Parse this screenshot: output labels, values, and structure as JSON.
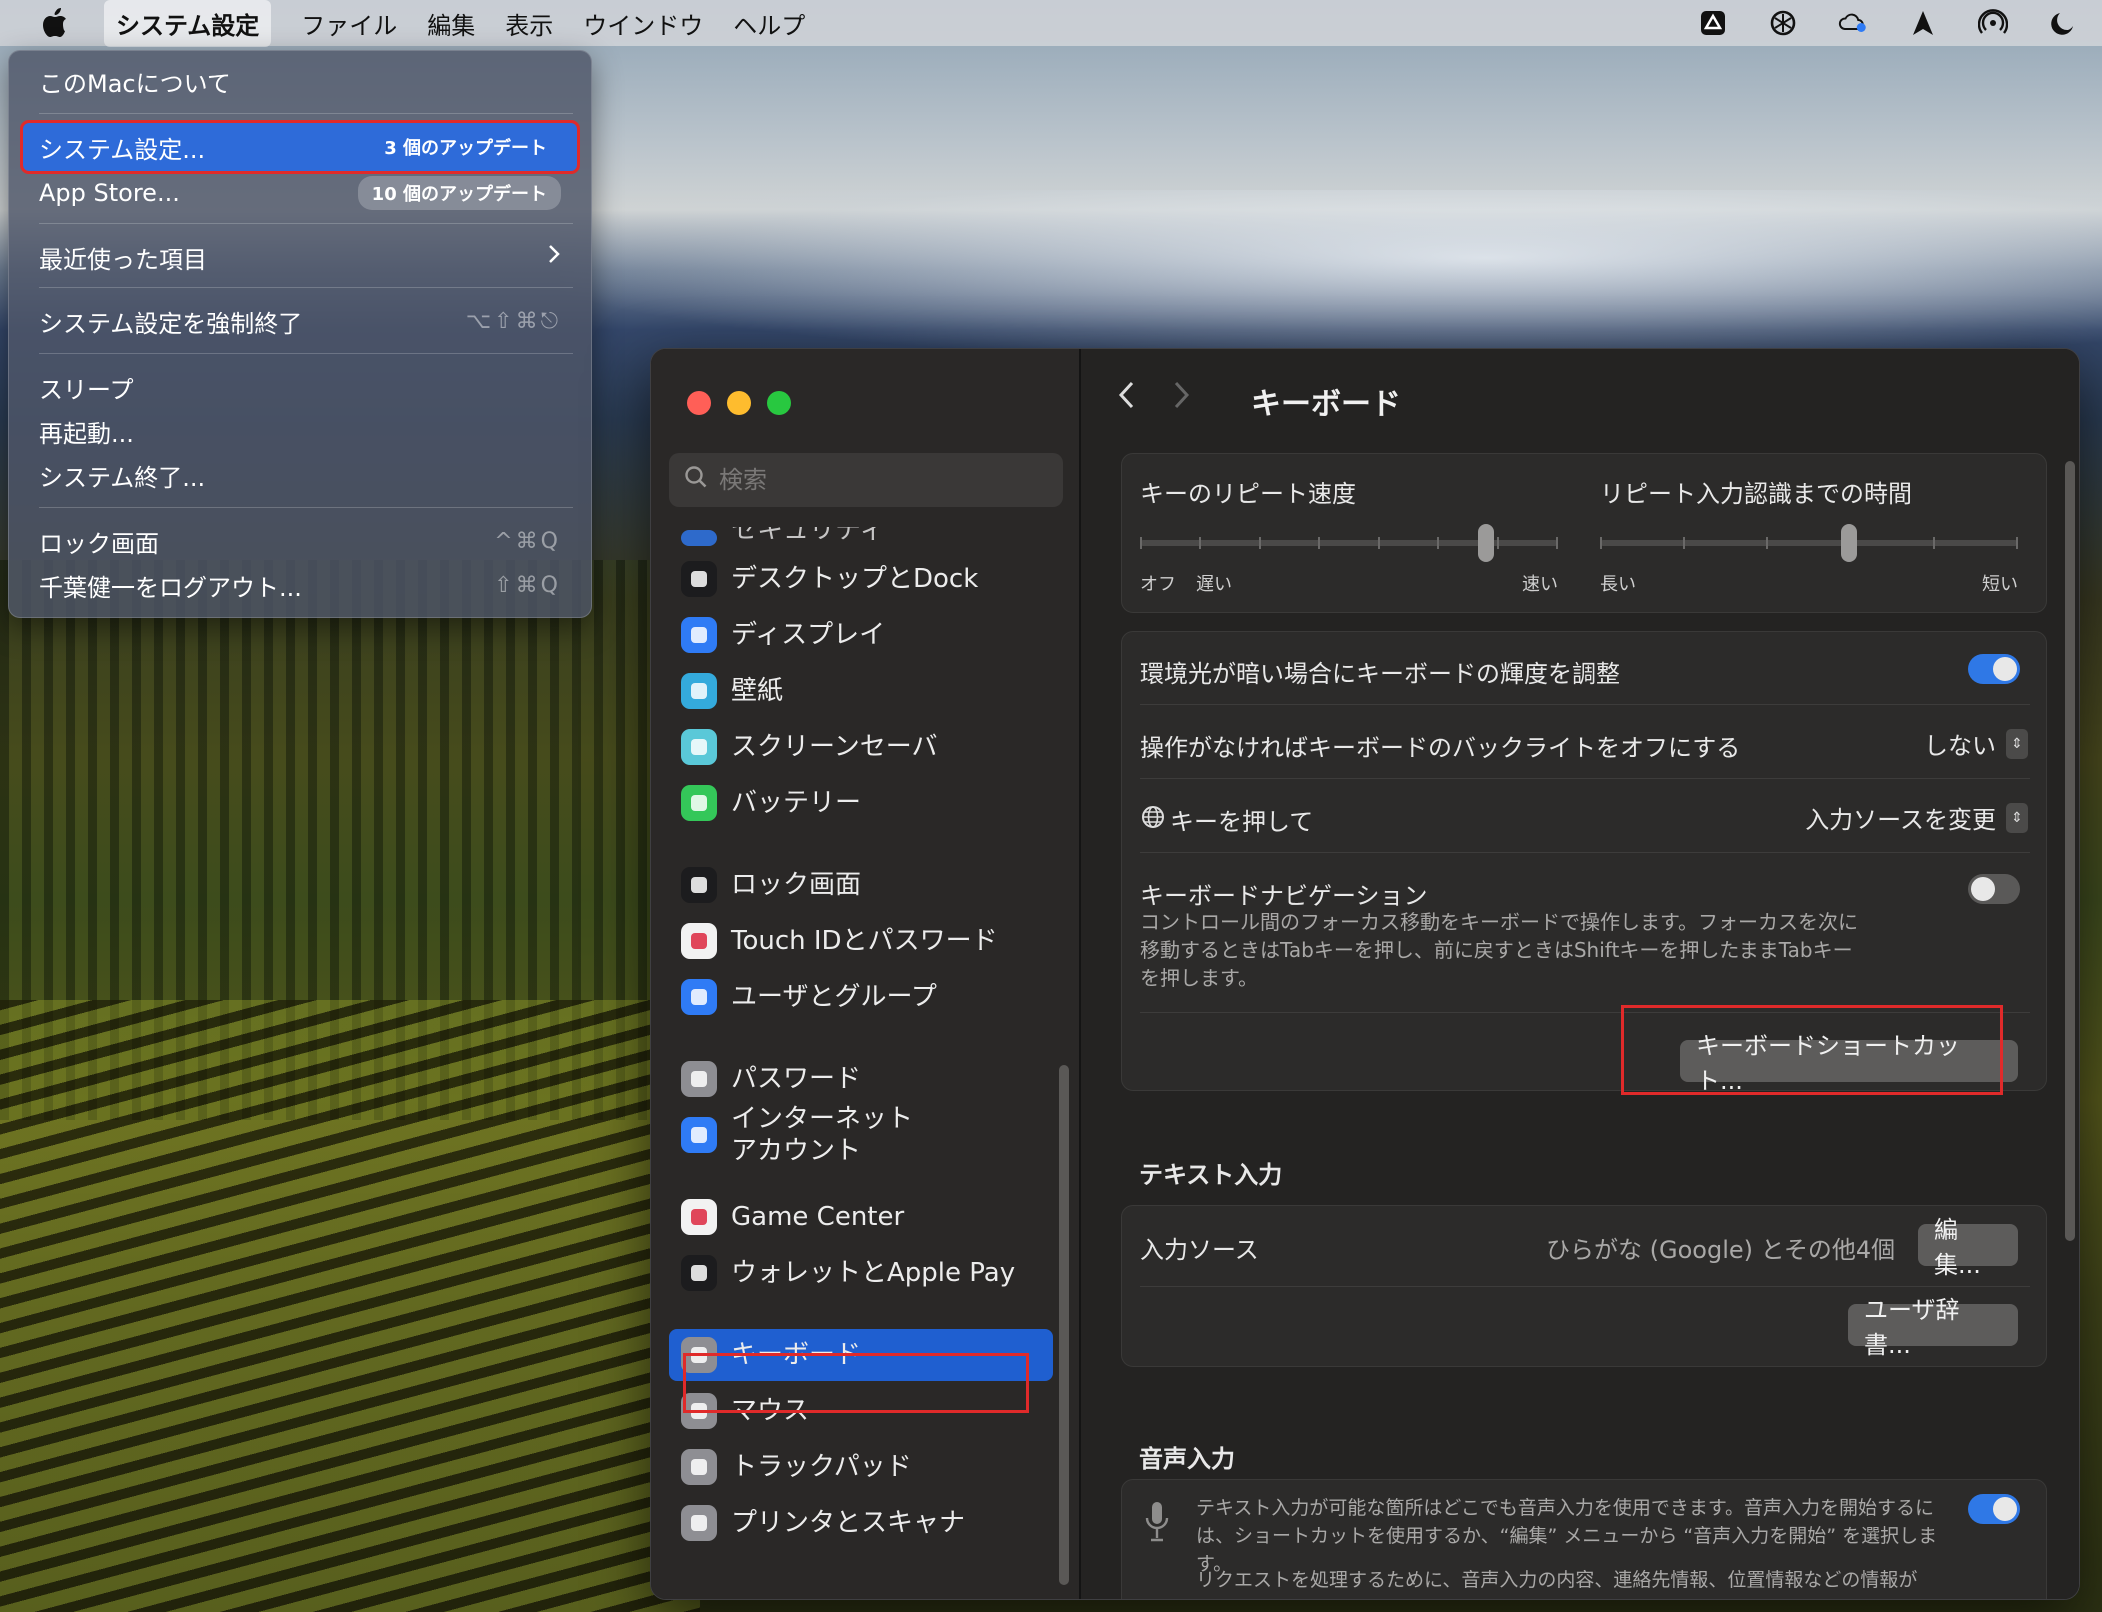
{
  "menubar": {
    "app_name": "システム設定",
    "items": [
      "ファイル",
      "編集",
      "表示",
      "ウインドウ",
      "ヘルプ"
    ],
    "status_icons": [
      "google-drive-icon",
      "chatgpt-icon",
      "cloud-sync-icon",
      "location-arrow-icon",
      "airdrop-icon",
      "dark-mode-icon"
    ]
  },
  "apple_menu": {
    "about": "このMacについて",
    "system_settings": "システム設定...",
    "system_settings_badge": "3 個のアップデート",
    "app_store": "App Store...",
    "app_store_badge": "10 個のアップデート",
    "recent_items": "最近使った項目",
    "force_quit": "システム設定を強制終了",
    "force_quit_shortcut": "⌥⇧⌘⎋",
    "sleep": "スリープ",
    "restart": "再起動...",
    "shutdown": "システム終了...",
    "lock_screen": "ロック画面",
    "lock_screen_shortcut": "^⌘Q",
    "logout": "千葉健一をログアウト...",
    "logout_shortcut": "⇧⌘Q"
  },
  "sidebar": {
    "search_placeholder": "検索",
    "partial_item": "セキュリティ",
    "items": [
      {
        "label": "デスクトップとDock",
        "icon": "dock-icon",
        "color": "#1c1c1e"
      },
      {
        "label": "ディスプレイ",
        "icon": "display-icon",
        "color": "#2f7bf5"
      },
      {
        "label": "壁紙",
        "icon": "wallpaper-icon",
        "color": "#34aadc"
      },
      {
        "label": "スクリーンセーバ",
        "icon": "screensaver-icon",
        "color": "#5ac8d8"
      },
      {
        "label": "バッテリー",
        "icon": "battery-icon",
        "color": "#34c759"
      },
      {
        "label": "ロック画面",
        "icon": "lock-icon",
        "color": "#1c1c1e"
      },
      {
        "label": "Touch IDとパスワード",
        "icon": "fingerprint-icon",
        "color": "#f2f2f2"
      },
      {
        "label": "ユーザとグループ",
        "icon": "users-icon",
        "color": "#2f7bf5"
      },
      {
        "label": "パスワード",
        "icon": "key-icon",
        "color": "#8e8e93"
      },
      {
        "label": "インターネット\nアカウント",
        "icon": "at-icon",
        "color": "#2f7bf5"
      },
      {
        "label": "Game Center",
        "icon": "game-center-icon",
        "color": "#f2f2f2"
      },
      {
        "label": "ウォレットとApple Pay",
        "icon": "wallet-icon",
        "color": "#1c1c1e"
      },
      {
        "label": "キーボード",
        "icon": "keyboard-icon",
        "color": "#8e8e93"
      },
      {
        "label": "マウス",
        "icon": "mouse-icon",
        "color": "#8e8e93"
      },
      {
        "label": "トラックパッド",
        "icon": "trackpad-icon",
        "color": "#8e8e93"
      },
      {
        "label": "プリンタとスキャナ",
        "icon": "printer-icon",
        "color": "#8e8e93"
      }
    ]
  },
  "content": {
    "title": "キーボード",
    "repeat_speed": {
      "label": "キーのリピート速度",
      "left": "オフ",
      "left2": "遅い",
      "right": "速い",
      "level": 0.84
    },
    "repeat_delay": {
      "label": "リピート入力認識までの時間",
      "left": "長い",
      "right": "短い",
      "level": 0.6
    },
    "ambient_light": {
      "label": "環境光が暗い場合にキーボードの輝度を調整",
      "on": true
    },
    "backlight_off": {
      "label": "操作がなければキーボードのバックライトをオフにする",
      "value": "しない"
    },
    "globe_key": {
      "label": "キーを押して",
      "value": "入力ソースを変更"
    },
    "keyboard_nav": {
      "label": "キーボードナビゲーション",
      "on": false,
      "desc": "コントロール間のフォーカス移動をキーボードで操作します。フォーカスを次に移動するときはTabキーを押し、前に戻すときはShiftキーを押したままTabキーを押します。"
    },
    "shortcuts_button": "キーボードショートカット...",
    "text_input": {
      "heading": "テキスト入力",
      "input_sources_label": "入力ソース",
      "input_sources_value": "ひらがな (Google) とその他4個",
      "edit_button": "編集...",
      "user_dict_button": "ユーザ辞書..."
    },
    "dictation": {
      "heading": "音声入力",
      "on": true,
      "desc1": "テキスト入力が可能な箇所はどこでも音声入力を使用できます。音声入力を開始するには、ショートカットを使用するか、“編集” メニューから “音声入力を開始” を選択します。",
      "desc2": "リクエストを処理するために、音声入力の内容、連絡先情報、位置情報などの情報が"
    }
  }
}
